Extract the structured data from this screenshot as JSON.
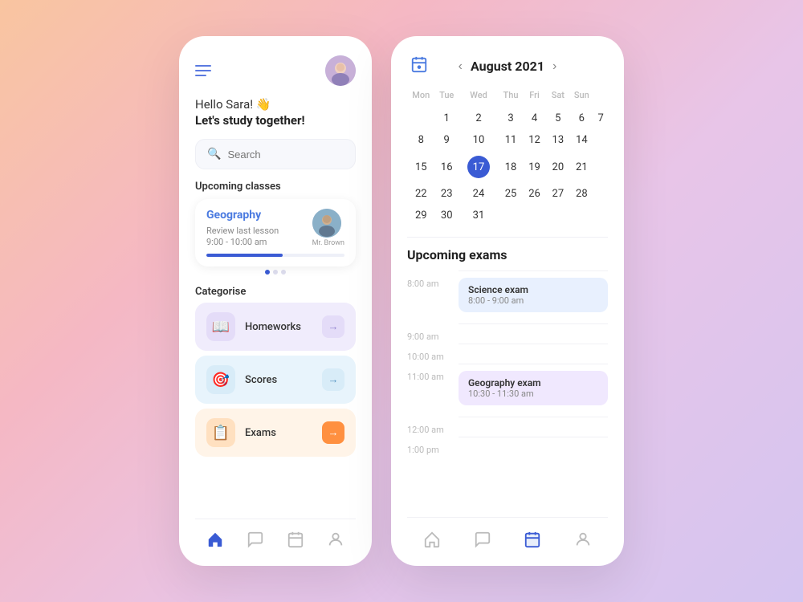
{
  "left": {
    "greeting_hello": "Hello Sara! 👋",
    "greeting_study": "Let's study together!",
    "search_placeholder": "Search",
    "upcoming_classes_title": "Upcoming classes",
    "class_subject": "Geography",
    "class_desc": "Review last lesson",
    "class_time": "9:00 - 10:00 am",
    "teacher_name": "Mr. Brown",
    "dots": [
      true,
      false,
      false
    ],
    "categorise_title": "Categorise",
    "categories": [
      {
        "name": "Homeworks",
        "icon": "📖",
        "bg": "#ede8fc",
        "icon_bg": "#e0d8f8",
        "arrow_bg": "#e0d8f8",
        "arrow_color": "#9080d0"
      },
      {
        "name": "Scores",
        "icon": "🎯",
        "bg": "#e8f4fc",
        "icon_bg": "#d8ecf8",
        "arrow_bg": "#d8ecf8",
        "arrow_color": "#5090c0"
      },
      {
        "name": "Exams",
        "icon": "📋",
        "bg": "#fff4e8",
        "icon_bg": "#ffe8d0",
        "arrow_bg": "#ff9040",
        "arrow_color": "#fff"
      }
    ],
    "nav": [
      {
        "icon": "🏠",
        "active": true,
        "label": "home"
      },
      {
        "icon": "💬",
        "active": false,
        "label": "messages"
      },
      {
        "icon": "📅",
        "active": false,
        "label": "calendar"
      },
      {
        "icon": "👤",
        "active": false,
        "label": "profile"
      }
    ]
  },
  "right": {
    "month": "August 2021",
    "days_header": [
      "Mon",
      "Tue",
      "Wed",
      "Thu",
      "Fri",
      "Sat",
      "Sun"
    ],
    "weeks": [
      [
        "",
        "1",
        "2",
        "3",
        "4",
        "5",
        "6",
        "7"
      ],
      [
        "",
        "8",
        "9",
        "10",
        "11",
        "12",
        "13",
        "14"
      ],
      [
        "today",
        "15",
        "16",
        "17",
        "18",
        "19",
        "20",
        "21"
      ],
      [
        "",
        "22",
        "23",
        "24",
        "25",
        "26",
        "27",
        "28"
      ],
      [
        "",
        "29",
        "30",
        "31",
        "",
        "",
        "",
        ""
      ]
    ],
    "upcoming_exams_title": "Upcoming exams",
    "time_slots": [
      {
        "time": "8:00 am",
        "exam": {
          "title": "Science exam",
          "time_range": "8:00 - 9:00 am",
          "style": "blue"
        }
      },
      {
        "time": "9:00 am",
        "exam": null
      },
      {
        "time": "10:00 am",
        "exam": null
      },
      {
        "time": "11:00 am",
        "exam": {
          "title": "Geography exam",
          "time_range": "10:30 - 11:30 am",
          "style": "purple"
        }
      },
      {
        "time": "12:00 am",
        "exam": null
      },
      {
        "time": "1:00 pm",
        "exam": null
      }
    ],
    "nav": [
      {
        "icon": "🏠",
        "active": false,
        "label": "home"
      },
      {
        "icon": "💬",
        "active": false,
        "label": "messages"
      },
      {
        "icon": "📅",
        "active": true,
        "label": "calendar"
      },
      {
        "icon": "👤",
        "active": false,
        "label": "profile"
      }
    ]
  }
}
